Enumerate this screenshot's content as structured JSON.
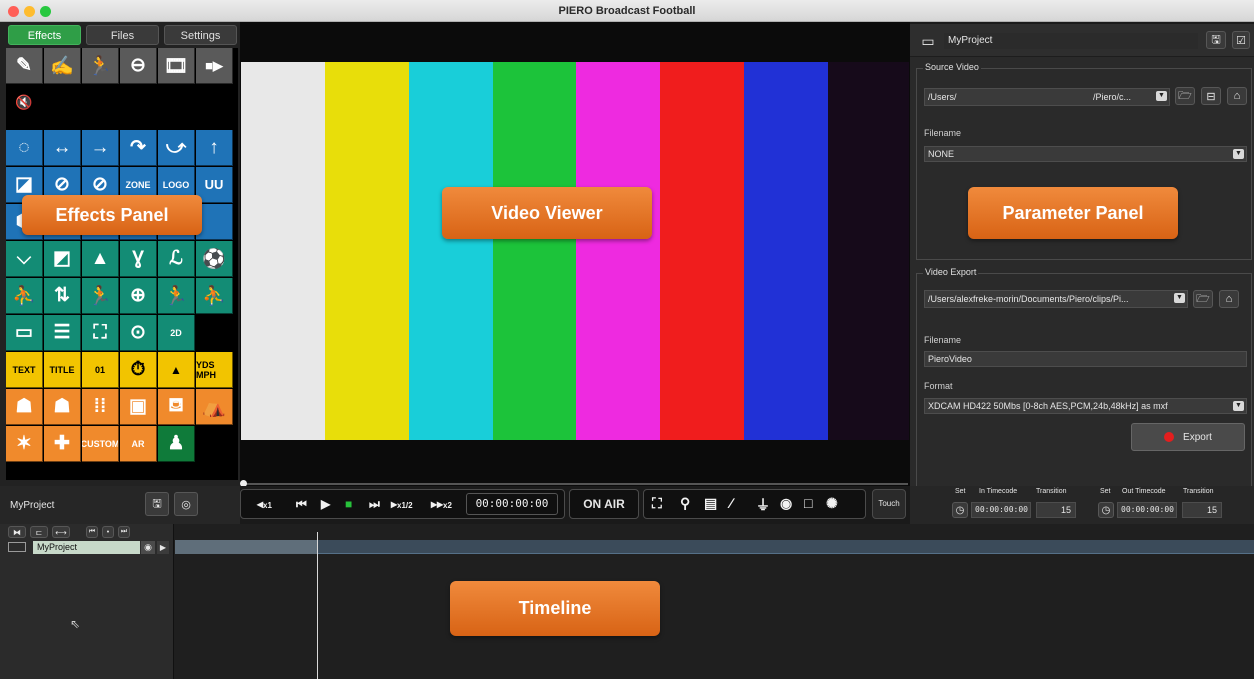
{
  "window": {
    "title": "PIERO Broadcast Football",
    "traffic_colors": [
      "#ff5f57",
      "#febc2e",
      "#28c840"
    ]
  },
  "tabs": {
    "effects": "Effects",
    "files": "Files",
    "settings": "Settings"
  },
  "effects_grid": {
    "row1": [
      "✎",
      "✍",
      "🏃",
      "⊖",
      "🎞",
      "■▶"
    ],
    "row2": [
      "🔇"
    ],
    "row3": [
      "◌",
      "↔",
      "→",
      "↷",
      "⤻",
      "↑"
    ],
    "row4": [
      "◪",
      "⊘",
      "⊘",
      "ZONE",
      "LOGO",
      "UU"
    ],
    "row5": [
      "⬢",
      "",
      "",
      "",
      "",
      ""
    ],
    "row6": [
      "⌵",
      "◩",
      "▲",
      "Ɣ",
      "ℒ",
      "⚽"
    ],
    "row7": [
      "⛹",
      "⇅",
      "🏃",
      "⊕",
      "🏃",
      "⛹"
    ],
    "row8": [
      "▭",
      "☰",
      "⛶",
      "⊙",
      "2D",
      ""
    ],
    "row9": [
      "TEXT",
      "TITLE",
      "01",
      "⏱",
      "▲",
      "YDS MPH"
    ],
    "row10": [
      "☗",
      "☗",
      "⁞⁞",
      "▣",
      "⛾",
      "⛺"
    ],
    "row11": [
      "✶",
      "✚",
      "CUSTOM",
      "AR",
      "♟",
      ""
    ],
    "colors": {
      "gray": "#5c5c5c",
      "blue": "#1f73b7",
      "teal": "#138c75",
      "yellow": "#f2c400",
      "orange": "#f08a2c"
    }
  },
  "overlays": {
    "effects": "Effects Panel",
    "video": "Video Viewer",
    "parameter": "Parameter Panel",
    "timeline": "Timeline"
  },
  "color_bars": [
    "#e8e8e8",
    "#e8de0a",
    "#19ced9",
    "#1cc33a",
    "#ee2ae0",
    "#f01d1d",
    "#2131d6",
    "#160a1a"
  ],
  "right_panel": {
    "project_name": "MyProject",
    "source_video": {
      "legend": "Source Video",
      "path_left": "/Users/",
      "path_right": "/Piero/c...",
      "filename_label": "Filename",
      "filename_value": "NONE"
    },
    "video_export": {
      "legend": "Video Export",
      "path": "/Users/alexfreke-morin/Documents/Piero/clips/Pi...",
      "filename_label": "Filename",
      "filename_value": "PieroVideo",
      "format_label": "Format",
      "format_value": "XDCAM HD422 50Mbs [0-8ch AES,PCM,24b,48kHz] as mxf",
      "export_label": "Export"
    }
  },
  "transport": {
    "project_label": "MyProject",
    "rew_label": "x1",
    "slow_label": "x1/2",
    "ff_label": "x2",
    "timecode": "00:00:00:00",
    "on_air": "ON AIR",
    "touch": "Touch"
  },
  "timecodes": {
    "set_label": "Set",
    "in_label": "In Timecode",
    "out_label": "Out Timecode",
    "transition_label": "Transition",
    "in_value": "00:00:00:00",
    "in_transition": "15",
    "out_value": "00:00:00:00",
    "out_transition": "15"
  },
  "timeline": {
    "track_name": "MyProject"
  }
}
